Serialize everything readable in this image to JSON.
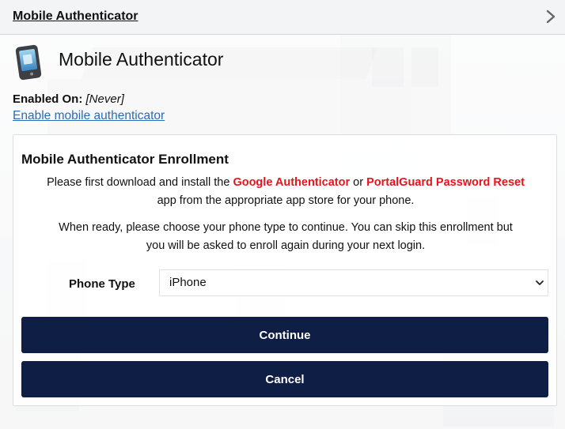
{
  "header": {
    "title": "Mobile Authenticator"
  },
  "icons": {
    "chevron": "chevron-right-icon",
    "app": "mobile-phone-icon",
    "select": "chevron-down-icon"
  },
  "page": {
    "title": "Mobile Authenticator",
    "enabled_label": "Enabled On:",
    "enabled_value": "[Never]",
    "enable_link": "Enable mobile authenticator"
  },
  "enrollment": {
    "title": "Mobile Authenticator Enrollment",
    "p1_part1": "Please first download and install the ",
    "app1": "Google Authenticator",
    "p1_or": " or ",
    "app2": "PortalGuard Password Reset",
    "p1_part2": "app from the appropriate app store for your phone.",
    "p2_line1": "When ready, please choose your phone type to continue. You can skip this enrollment but",
    "p2_line2": "you will be asked to enroll again during your next login.",
    "phone_type_label": "Phone Type",
    "phone_type_value": "iPhone",
    "continue_label": "Continue",
    "cancel_label": "Cancel"
  },
  "colors": {
    "accent_navy": "#0f1e45",
    "link_blue": "#2a6db5",
    "highlight_red": "#e8131b"
  }
}
